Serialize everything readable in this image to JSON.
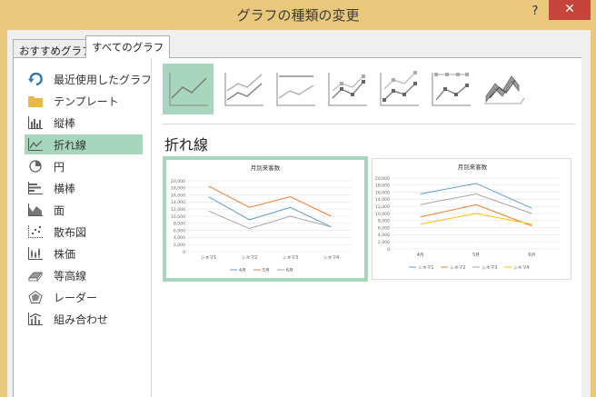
{
  "window": {
    "title": "グラフの種類の変更",
    "help_label": "?",
    "close_label": "✕"
  },
  "tabs": [
    {
      "label": "おすすめグラフ"
    },
    {
      "label": "すべてのグラフ"
    }
  ],
  "sidebar": {
    "items": [
      {
        "label": "最近使用したグラフ",
        "icon": "recent-icon"
      },
      {
        "label": "テンプレート",
        "icon": "folder-icon"
      },
      {
        "label": "縦棒",
        "icon": "column-chart-icon"
      },
      {
        "label": "折れ線",
        "icon": "line-chart-icon",
        "selected": true
      },
      {
        "label": "円",
        "icon": "pie-chart-icon"
      },
      {
        "label": "横棒",
        "icon": "bar-chart-icon"
      },
      {
        "label": "面",
        "icon": "area-chart-icon"
      },
      {
        "label": "散布図",
        "icon": "scatter-chart-icon"
      },
      {
        "label": "株価",
        "icon": "stock-chart-icon"
      },
      {
        "label": "等高線",
        "icon": "surface-chart-icon"
      },
      {
        "label": "レーダー",
        "icon": "radar-chart-icon"
      },
      {
        "label": "組み合わせ",
        "icon": "combo-chart-icon"
      }
    ]
  },
  "subtypes": [
    {
      "icon": "line-icon",
      "selected": true
    },
    {
      "icon": "stacked-line-icon"
    },
    {
      "icon": "100-stacked-line-icon"
    },
    {
      "icon": "line-markers-icon"
    },
    {
      "icon": "stacked-line-markers-icon"
    },
    {
      "icon": "100-stacked-line-markers-icon"
    },
    {
      "icon": "3d-line-icon"
    }
  ],
  "section_heading": "折れ線",
  "colors": {
    "accent_selected": "#a8d5bd",
    "titlebar": "#e9c77b",
    "close": "#c7443a",
    "series_blue": "#5b9bd5",
    "series_orange": "#ed7d31",
    "series_gray": "#a5a5a5",
    "series_yellow": "#ffc000"
  },
  "chart_data": [
    {
      "type": "line",
      "title": "月別来客数",
      "categories": [
        "シネマ1",
        "シネマ2",
        "シネマ3",
        "シネマ4"
      ],
      "y_ticks": [
        "20,000",
        "18,000",
        "16,000",
        "14,000",
        "12,000",
        "10,000",
        "8,000",
        "6,000",
        "4,000",
        "2,000",
        "0"
      ],
      "ylim": [
        0,
        20000
      ],
      "series": [
        {
          "name": "4月",
          "values": [
            15500,
            9000,
            12500,
            7000
          ]
        },
        {
          "name": "5月",
          "values": [
            18500,
            12500,
            15500,
            10000
          ]
        },
        {
          "name": "6月",
          "values": [
            11500,
            6500,
            10000,
            7000
          ]
        }
      ],
      "legend": "bottom",
      "grid": true
    },
    {
      "type": "line",
      "title": "月別来客数",
      "categories": [
        "4月",
        "5月",
        "6月"
      ],
      "y_ticks": [
        "20,000",
        "18,000",
        "16,000",
        "14,000",
        "12,000",
        "10,000",
        "8,000",
        "6,000",
        "4,000",
        "2,000",
        "0"
      ],
      "ylim": [
        0,
        20000
      ],
      "series": [
        {
          "name": "シネマ1",
          "values": [
            15500,
            18500,
            11500
          ]
        },
        {
          "name": "シネマ2",
          "values": [
            9000,
            12500,
            6500
          ]
        },
        {
          "name": "シネマ3",
          "values": [
            12500,
            15500,
            10000
          ]
        },
        {
          "name": "シネマ4",
          "values": [
            7000,
            10000,
            7000
          ]
        }
      ],
      "legend": "bottom",
      "grid": true
    }
  ]
}
